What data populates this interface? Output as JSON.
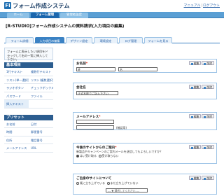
{
  "header": {
    "logo_glyph": "Fi",
    "title": "フォーム作成システム",
    "links": [
      "マニュアル",
      "ログアウト"
    ]
  },
  "topnav": [
    "ホーム",
    "フォーム管理",
    "管理者設定"
  ],
  "page_title": "[R-STUDIO]フォーム作成システムの資料請求(入力項目の編集)",
  "subtabs": [
    "フォーム詳細",
    "入力項目の編集",
    "デザイン設定",
    "環境設定",
    "ログ管理",
    "フォームを見る"
  ],
  "sidebar": {
    "help": "フォームに表示したい項目をドラッグして右の一覧に挿入して下さい。",
    "basic_title": "基本項目",
    "basic_items": [
      "1行テキスト",
      "複数行テキスト",
      "リスト(単一選択)",
      "リスト(複数選択)",
      "ラジオボタン",
      "チェックボックス",
      "パスワード",
      "ファイル",
      "挿入テキスト",
      ""
    ],
    "preset_title": "プリセット",
    "preset_items": [
      "お名前",
      "日付",
      "時間",
      "郵便番号",
      "住所",
      "電話番号",
      "メールアドレス",
      "URL"
    ]
  },
  "buttons": {
    "edit": "編集",
    "delete": "削除"
  },
  "fields": {
    "name": {
      "label": "お名前",
      "req": "*",
      "sei": "姓",
      "mei": "名"
    },
    "company": {
      "label": "会社名",
      "placeholder": "正式名称でご記入下さい"
    },
    "email": {
      "label": "メールアドレス",
      "req": "*",
      "note": "(確認用)"
    },
    "inquiry": {
      "label": "今後のサイトからのご案内",
      "req": "*",
      "desc": "新製品やキャンペーンのご案内メールを送信してもよろしいですか？",
      "options": [
        "はい受け取る",
        "受け取らない"
      ],
      "selected": 0
    },
    "usage": {
      "label": "ご自身のサイトについて",
      "options": [
        "既に立ち上げている",
        "まだ立ち上げていない"
      ],
      "select_placeholder": "--- ▼ 選択してください ---"
    }
  },
  "colors": {
    "accent": "#3b82c4",
    "nav": "#5a9fd4",
    "header_text": "#1d3f66",
    "required": "#dd2211"
  }
}
